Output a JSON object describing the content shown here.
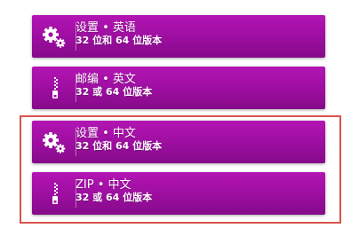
{
  "downloads": [
    {
      "icon": "gears-icon",
      "title": "设置 • 英语",
      "subtitle": "32 位和 64 位版本"
    },
    {
      "icon": "zip-icon",
      "title": "邮编 • 英文",
      "subtitle": "32 或 64 位版本"
    },
    {
      "icon": "gears-icon",
      "title": "设置 • 中文",
      "subtitle": "32 位和 64 位版本"
    },
    {
      "icon": "zip-icon",
      "title": "ZIP • 中文",
      "subtitle": "32 或 64 位版本"
    }
  ],
  "colors": {
    "button_top": "#b315b3",
    "button_bottom": "#860a8a",
    "highlight_border": "#d9534f"
  }
}
